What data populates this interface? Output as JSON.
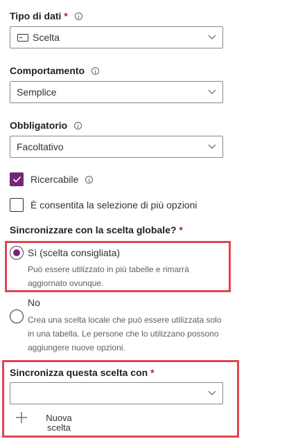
{
  "data_type": {
    "label": "Tipo di dati",
    "required_mark": "*",
    "selected": "Scelta",
    "selected_icon": "choice-icon"
  },
  "behavior": {
    "label": "Comportamento",
    "selected": "Semplice"
  },
  "required": {
    "label": "Obbligatorio",
    "selected": "Facoltativo"
  },
  "searchable": {
    "label": "Ricercabile",
    "checked": true
  },
  "multi_select": {
    "label": "È consentita la selezione di più opzioni",
    "checked": false
  },
  "sync_global": {
    "label": "Sincronizzare con la scelta globale?",
    "required_mark": "*",
    "options": [
      {
        "label": "Sì (scelta consigliata)",
        "desc_line1": "Può essere utilizzato in più tabelle e rimarrà",
        "desc_line2": "aggiornato ovunque.",
        "selected": true
      },
      {
        "label": "No",
        "desc_line1": "Crea una scelta locale che può essere utilizzata solo",
        "desc_line2": "in una tabella. Le persone che lo utilizzano possono",
        "desc_line3": "aggiungere nuove opzioni.",
        "selected": false
      }
    ]
  },
  "sync_with": {
    "label": "Sincronizza questa scelta con",
    "required_mark": "*",
    "selected": "",
    "new_choice_line1": "Nuova",
    "new_choice_line2": "scelta"
  },
  "colors": {
    "accent": "#742774",
    "highlight": "#e0454f",
    "required": "#a4262c"
  }
}
